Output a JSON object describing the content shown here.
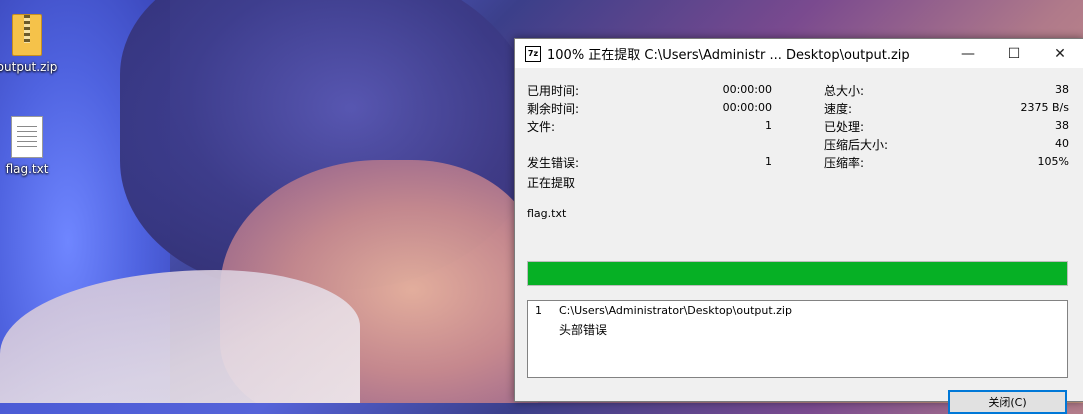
{
  "desktop": {
    "icons": [
      {
        "label": "output.zip",
        "icon": "zip-folder-icon"
      },
      {
        "label": "flag.txt",
        "icon": "text-file-icon"
      }
    ]
  },
  "window": {
    "app_icon_text": "7z",
    "title": "100% 正在提取 C:\\Users\\Administr ... Desktop\\output.zip",
    "controls": {
      "minimize": "—",
      "maximize": "☐",
      "close": "✕"
    }
  },
  "stats": {
    "elapsed_label": "已用时间:",
    "elapsed_value": "00:00:00",
    "remaining_label": "剩余时间:",
    "remaining_value": "00:00:00",
    "files_label": "文件:",
    "files_value": "1",
    "errors_label": "发生错误:",
    "errors_value": "1",
    "total_size_label": "总大小:",
    "total_size_value": "38",
    "speed_label": "速度:",
    "speed_value": "2375 B/s",
    "processed_label": "已处理:",
    "processed_value": "38",
    "compressed_label": "压缩后大小:",
    "compressed_value": "40",
    "ratio_label": "压缩率:",
    "ratio_value": "105%"
  },
  "operation_status": "正在提取",
  "current_file": "flag.txt",
  "progress": {
    "percent": 100,
    "color": "#06b025"
  },
  "errors": [
    {
      "num": "1",
      "path": "C:\\Users\\Administrator\\Desktop\\output.zip",
      "message": "头部错误"
    }
  ],
  "buttons": {
    "close_label": "关闭(C)"
  }
}
